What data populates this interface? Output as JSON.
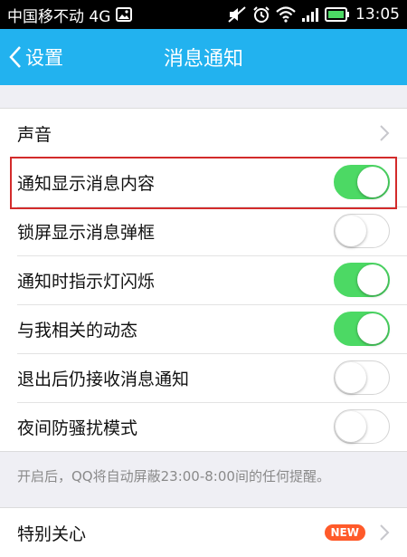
{
  "status_bar": {
    "carrier": "中国移不动 4G",
    "time": "13:05",
    "icons": [
      "image-icon",
      "mute-icon",
      "alarm-icon",
      "wifi-icon",
      "signal-icon",
      "battery-icon"
    ]
  },
  "nav": {
    "back_label": "设置",
    "title": "消息通知"
  },
  "settings": [
    {
      "label": "声音",
      "type": "link"
    },
    {
      "label": "通知显示消息内容",
      "type": "toggle",
      "on": true,
      "highlighted": true
    },
    {
      "label": "锁屏显示消息弹框",
      "type": "toggle",
      "on": false
    },
    {
      "label": "通知时指示灯闪烁",
      "type": "toggle",
      "on": true
    },
    {
      "label": "与我相关的动态",
      "type": "toggle",
      "on": true
    },
    {
      "label": "退出后仍接收消息通知",
      "type": "toggle",
      "on": false
    },
    {
      "label": "夜间防骚扰模式",
      "type": "toggle",
      "on": false
    }
  ],
  "night_mode_note": "开启后，QQ将自动屏蔽23:00-8:00间的任何提醒。",
  "special_care": {
    "label": "特别关心",
    "badge": "NEW"
  },
  "colors": {
    "nav_bg": "#22b2ef",
    "toggle_on": "#4cd964",
    "highlight_border": "#d32b2b",
    "badge_bg": "#ff5a2a"
  }
}
